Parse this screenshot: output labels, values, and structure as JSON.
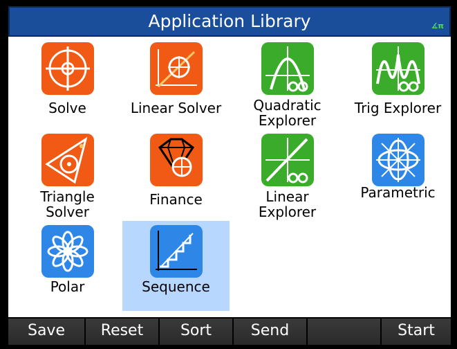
{
  "title": "Application Library",
  "angle_indicator": "∡π",
  "apps": [
    {
      "name": "solve",
      "label_lines": [
        "Solve"
      ],
      "icon": "solve-icon"
    },
    {
      "name": "linear-solver",
      "label_lines": [
        "Linear Solver"
      ],
      "icon": "linear-solver-icon"
    },
    {
      "name": "quadratic-explorer",
      "label_lines": [
        "Quadratic",
        "Explorer"
      ],
      "icon": "quadratic-explorer-icon"
    },
    {
      "name": "trig-explorer",
      "label_lines": [
        "Trig Explorer"
      ],
      "icon": "trig-explorer-icon"
    },
    {
      "name": "triangle-solver",
      "label_lines": [
        "Triangle",
        "Solver"
      ],
      "icon": "triangle-solver-icon"
    },
    {
      "name": "finance",
      "label_lines": [
        "Finance"
      ],
      "icon": "finance-icon"
    },
    {
      "name": "linear-explorer",
      "label_lines": [
        "Linear",
        "Explorer"
      ],
      "icon": "linear-explorer-icon"
    },
    {
      "name": "parametric",
      "label_lines": [
        "Parametric"
      ],
      "icon": "parametric-icon"
    },
    {
      "name": "polar",
      "label_lines": [
        "Polar"
      ],
      "icon": "polar-icon"
    },
    {
      "name": "sequence",
      "label_lines": [
        "Sequence"
      ],
      "icon": "sequence-icon",
      "selected": true
    }
  ],
  "softkeys": [
    "Save",
    "Reset",
    "Sort",
    "Send",
    "",
    "Start"
  ],
  "colors": {
    "title_bar": "#1a4e9a",
    "selection": "#b7d7ff",
    "orange_icon": "#f05a14",
    "green_icon": "#3aab2a",
    "blue_icon": "#2e86e6"
  }
}
